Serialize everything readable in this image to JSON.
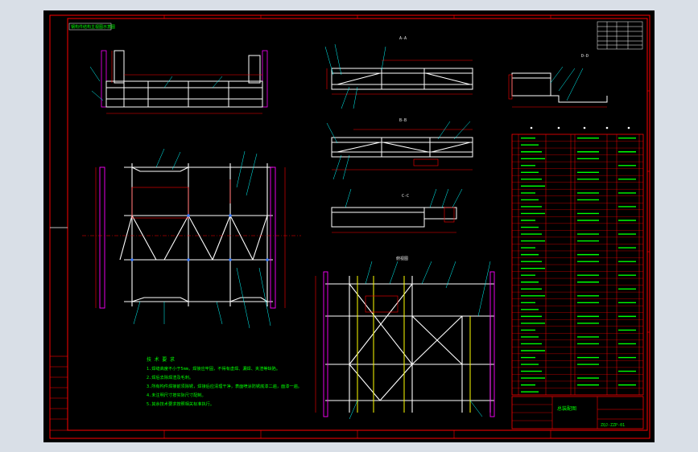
{
  "drawing": {
    "top_left_tag": "钢构件结构主视图示意图",
    "view_labels": {
      "section_aa": "A-A",
      "section_bb": "B-B",
      "section_cc": "C-C",
      "section_dd": "D-D",
      "plan_view": "俯视图"
    },
    "tech_notes": {
      "title": "技 术 要 求",
      "lines": [
        "1.焊缝高度不小于5mm，焊接应牢固，不得有虚焊、漏焊、夹渣等缺陷。",
        "2.焊后去除焊渣及毛刺。",
        "3.所有构件焊接前须除锈，焊接后应清理干净，表面喷涂防锈底漆二遍，面漆一遍。",
        "4.未注明尺寸按实际尺寸配制。",
        "5.其余技术要求按照相关标准执行。"
      ]
    },
    "title_block": {
      "name_text": "总装配图",
      "code_text": "ZQJ-ZZP-01"
    },
    "colors": {
      "frame": "#ff0000",
      "beam": "#ffffff",
      "leader": "#00ffff",
      "text": "#00ff00",
      "accent": "#ff00ff",
      "highlight": "#ffff00"
    }
  }
}
